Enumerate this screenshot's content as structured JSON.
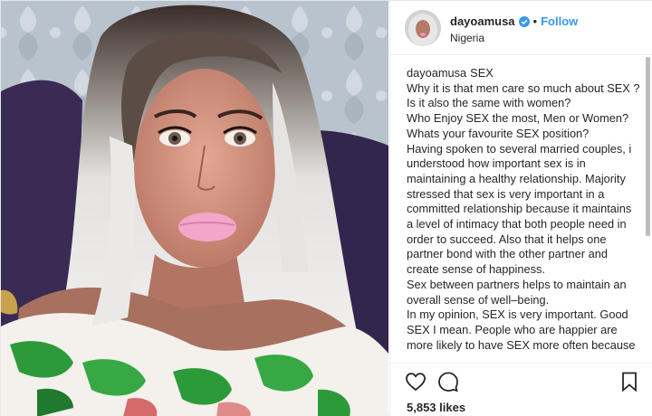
{
  "post": {
    "username": "dayoamusa",
    "follow_label": "Follow",
    "separator": "•",
    "location": "Nigeria",
    "caption_user": "dayoamusa",
    "caption_lines": [
      "SEX",
      "Why it is that men care so much about SEX ?",
      "Is it also the same with women?",
      "Who Enjoy SEX the most, Men or Women?",
      "Whats your favourite SEX position?",
      "Having spoken to several married couples, i understood how important sex is in maintaining a healthy relationship. Majority stressed that sex is very important in a committed relationship because it maintains a level of intimacy that both people need in order to succeed. Also that it helps one partner bond with the other partner and create sense of happiness.",
      "Sex between partners helps to maintain an overall sense of well–being.",
      "In my opinion, SEX is very important. Good SEX I mean. People who are happier are more likely to have SEX more often because"
    ],
    "likes_text": "5,853 likes"
  },
  "icons": {
    "verified": "verified-badge-icon",
    "like": "heart-icon",
    "comment": "comment-icon",
    "save": "bookmark-icon"
  },
  "colors": {
    "accent": "#3897f0",
    "text": "#262626",
    "border": "#efefef"
  }
}
